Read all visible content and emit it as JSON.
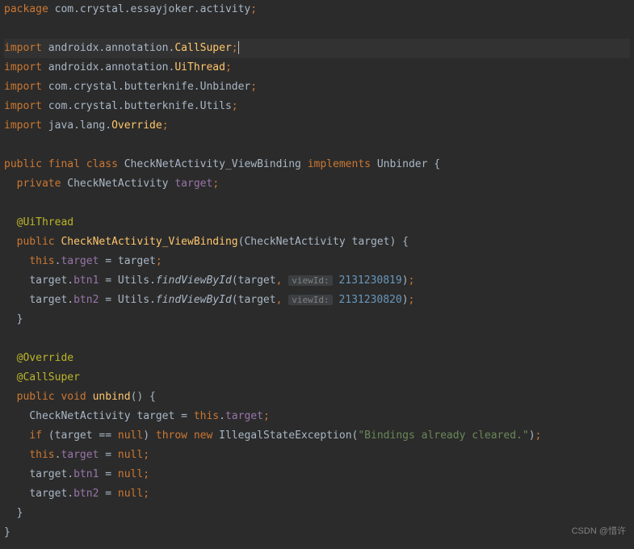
{
  "lines": {
    "pkg": {
      "kw": "package",
      "path": "com.crystal.essayjoker.activity"
    },
    "imp1": {
      "kw": "import",
      "path": "androidx.annotation.",
      "cls": "CallSuper"
    },
    "imp2": {
      "kw": "import",
      "path": "androidx.annotation.",
      "cls": "UiThread"
    },
    "imp3": {
      "kw": "import",
      "path": "com.crystal.butterknife.Unbinder"
    },
    "imp4": {
      "kw": "import",
      "path": "com.crystal.butterknife.Utils"
    },
    "imp5": {
      "kw": "import",
      "path": "java.lang.",
      "cls": "Override"
    },
    "classDecl": {
      "public": "public",
      "final": "final",
      "class": "class",
      "name": "CheckNetActivity_ViewBinding",
      "implements": "implements",
      "iface": "Unbinder"
    },
    "fieldDecl": {
      "private": "private",
      "type": "CheckNetActivity",
      "name": "target"
    },
    "uiThread": "@UiThread",
    "ctor": {
      "public": "public",
      "name": "CheckNetActivity_ViewBinding",
      "ptype": "CheckNetActivity",
      "pname": "target"
    },
    "assignThis": {
      "this": "this",
      "member": "target",
      "rhs": "target"
    },
    "find1": {
      "lhs_obj": "target",
      "lhs_member": "btn1",
      "cls": "Utils",
      "method": "findViewById",
      "arg1": "target",
      "tag": "viewId:",
      "num": "2131230819"
    },
    "find2": {
      "lhs_obj": "target",
      "lhs_member": "btn2",
      "cls": "Utils",
      "method": "findViewById",
      "arg1": "target",
      "tag": "viewId:",
      "num": "2131230820"
    },
    "override": "@Override",
    "callSuper": "@CallSuper",
    "unbind": {
      "public": "public",
      "void": "void",
      "name": "unbind"
    },
    "local": {
      "type": "CheckNetActivity",
      "name": "target",
      "this": "this",
      "member": "target"
    },
    "ifline": {
      "if": "if",
      "lhs": "target",
      "eq": "==",
      "null": "null",
      "throw": "throw",
      "new": "new",
      "exc": "IllegalStateException",
      "msg": "\"Bindings already cleared.\""
    },
    "nullThis": {
      "this": "this",
      "member": "target",
      "null": "null"
    },
    "null1": {
      "obj": "target",
      "member": "btn1",
      "null": "null"
    },
    "null2": {
      "obj": "target",
      "member": "btn2",
      "null": "null"
    }
  },
  "watermark": "CSDN @惜许"
}
